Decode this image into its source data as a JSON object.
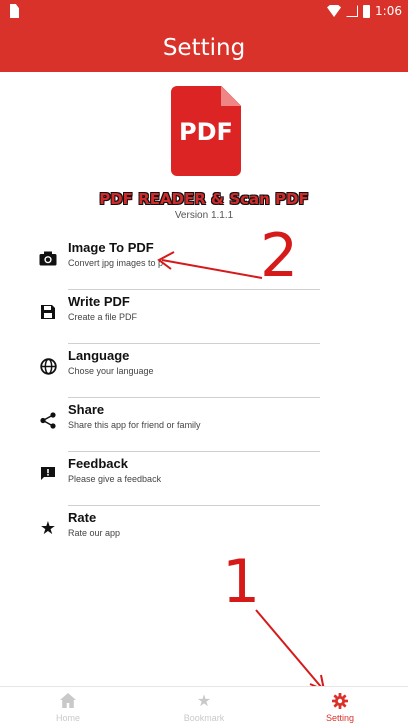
{
  "status_bar": {
    "time": "1:06"
  },
  "app_bar": {
    "title": "Setting"
  },
  "header": {
    "logo_text": "PDF",
    "app_name": "PDF READER & Scan PDF",
    "version": "Version 1.1.1"
  },
  "menu": [
    {
      "label": "Image To PDF",
      "sub": "Convert jpg images to p",
      "icon": "camera-icon"
    },
    {
      "label": "Write PDF",
      "sub": "Create a file PDF",
      "icon": "save-icon"
    },
    {
      "label": "Language",
      "sub": "Chose your language",
      "icon": "globe-icon"
    },
    {
      "label": "Share",
      "sub": "Share this app for friend or family",
      "icon": "share-icon"
    },
    {
      "label": "Feedback",
      "sub": "Please give a feedback",
      "icon": "feedback-icon"
    },
    {
      "label": "Rate",
      "sub": "Rate our app",
      "icon": "star-icon"
    }
  ],
  "annotations": {
    "one": "1",
    "two": "2"
  },
  "bottom_nav": [
    {
      "label": "Home",
      "icon": "home-icon",
      "active": false
    },
    {
      "label": "Bookmark",
      "icon": "star-icon",
      "active": false
    },
    {
      "label": "Setting",
      "icon": "gear-icon",
      "active": true
    }
  ],
  "colors": {
    "primary": "#d9322a",
    "inactive": "#c9c9c9"
  }
}
